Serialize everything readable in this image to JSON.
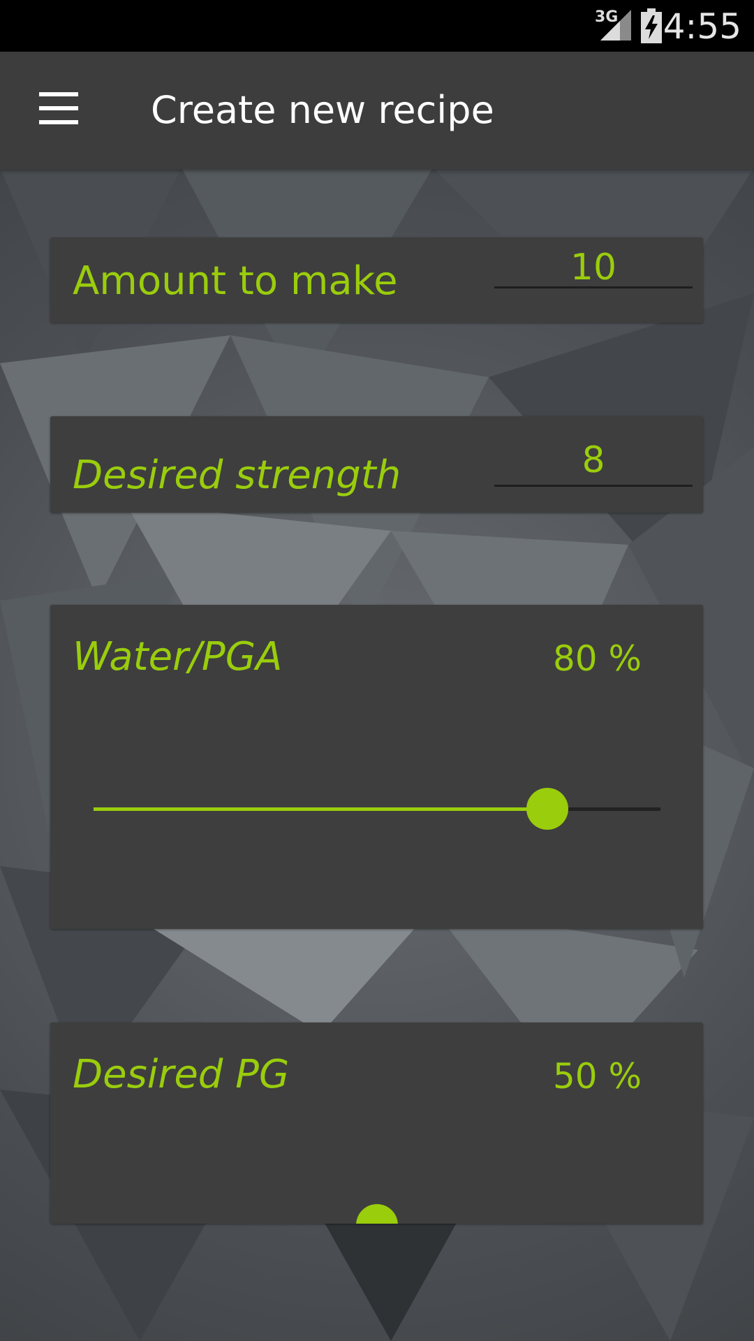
{
  "status_bar": {
    "network": "3G",
    "time": "4:55"
  },
  "app_bar": {
    "title": "Create new recipe",
    "menu_icon": "hamburger-menu-icon"
  },
  "form": {
    "amount": {
      "label": "Amount to make",
      "value": "10"
    },
    "strength": {
      "label": "Desired strength",
      "value": "8"
    },
    "water_pga": {
      "label": "Water/PGA",
      "value_text": "80 %",
      "slider_fraction": 0.8
    },
    "desired_pg": {
      "label": "Desired PG",
      "value_text": "50 %",
      "slider_fraction": 0.5
    }
  },
  "colors": {
    "accent": "#9acd0c",
    "card_background": "#3e3e3e",
    "app_bar": "#3d3d3d"
  }
}
